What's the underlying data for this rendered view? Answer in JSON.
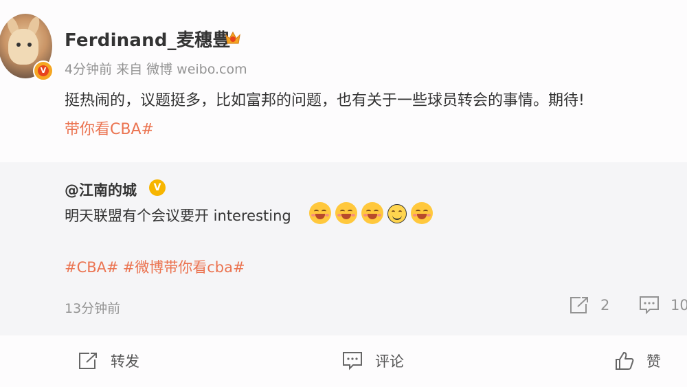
{
  "post": {
    "username": "Ferdinand_麦穗豊",
    "time": "4分钟前",
    "source_prefix": "来自",
    "source": "微博 weibo.com",
    "content": "挺热闹的，议题挺多，比如富邦的问题，也有关于一些球员转会的事情。期待!",
    "hashtag": "带你看CBA#"
  },
  "quote": {
    "author": "@江南的城",
    "text": "明天联盟有个会议要开 interesting",
    "tags": [
      "#CBA#",
      "#微博带你看cba#"
    ],
    "time": "13分钟前",
    "repost_count": "2",
    "comment_count": "10"
  },
  "actions": {
    "repost": "转发",
    "comment": "评论",
    "like": "赞"
  },
  "colors": {
    "accent": "#eb7350",
    "muted": "#939393",
    "quote_bg": "#f5f5f7"
  },
  "icons": [
    "crown-icon",
    "verified-icon",
    "share-icon",
    "comment-icon",
    "like-icon"
  ]
}
